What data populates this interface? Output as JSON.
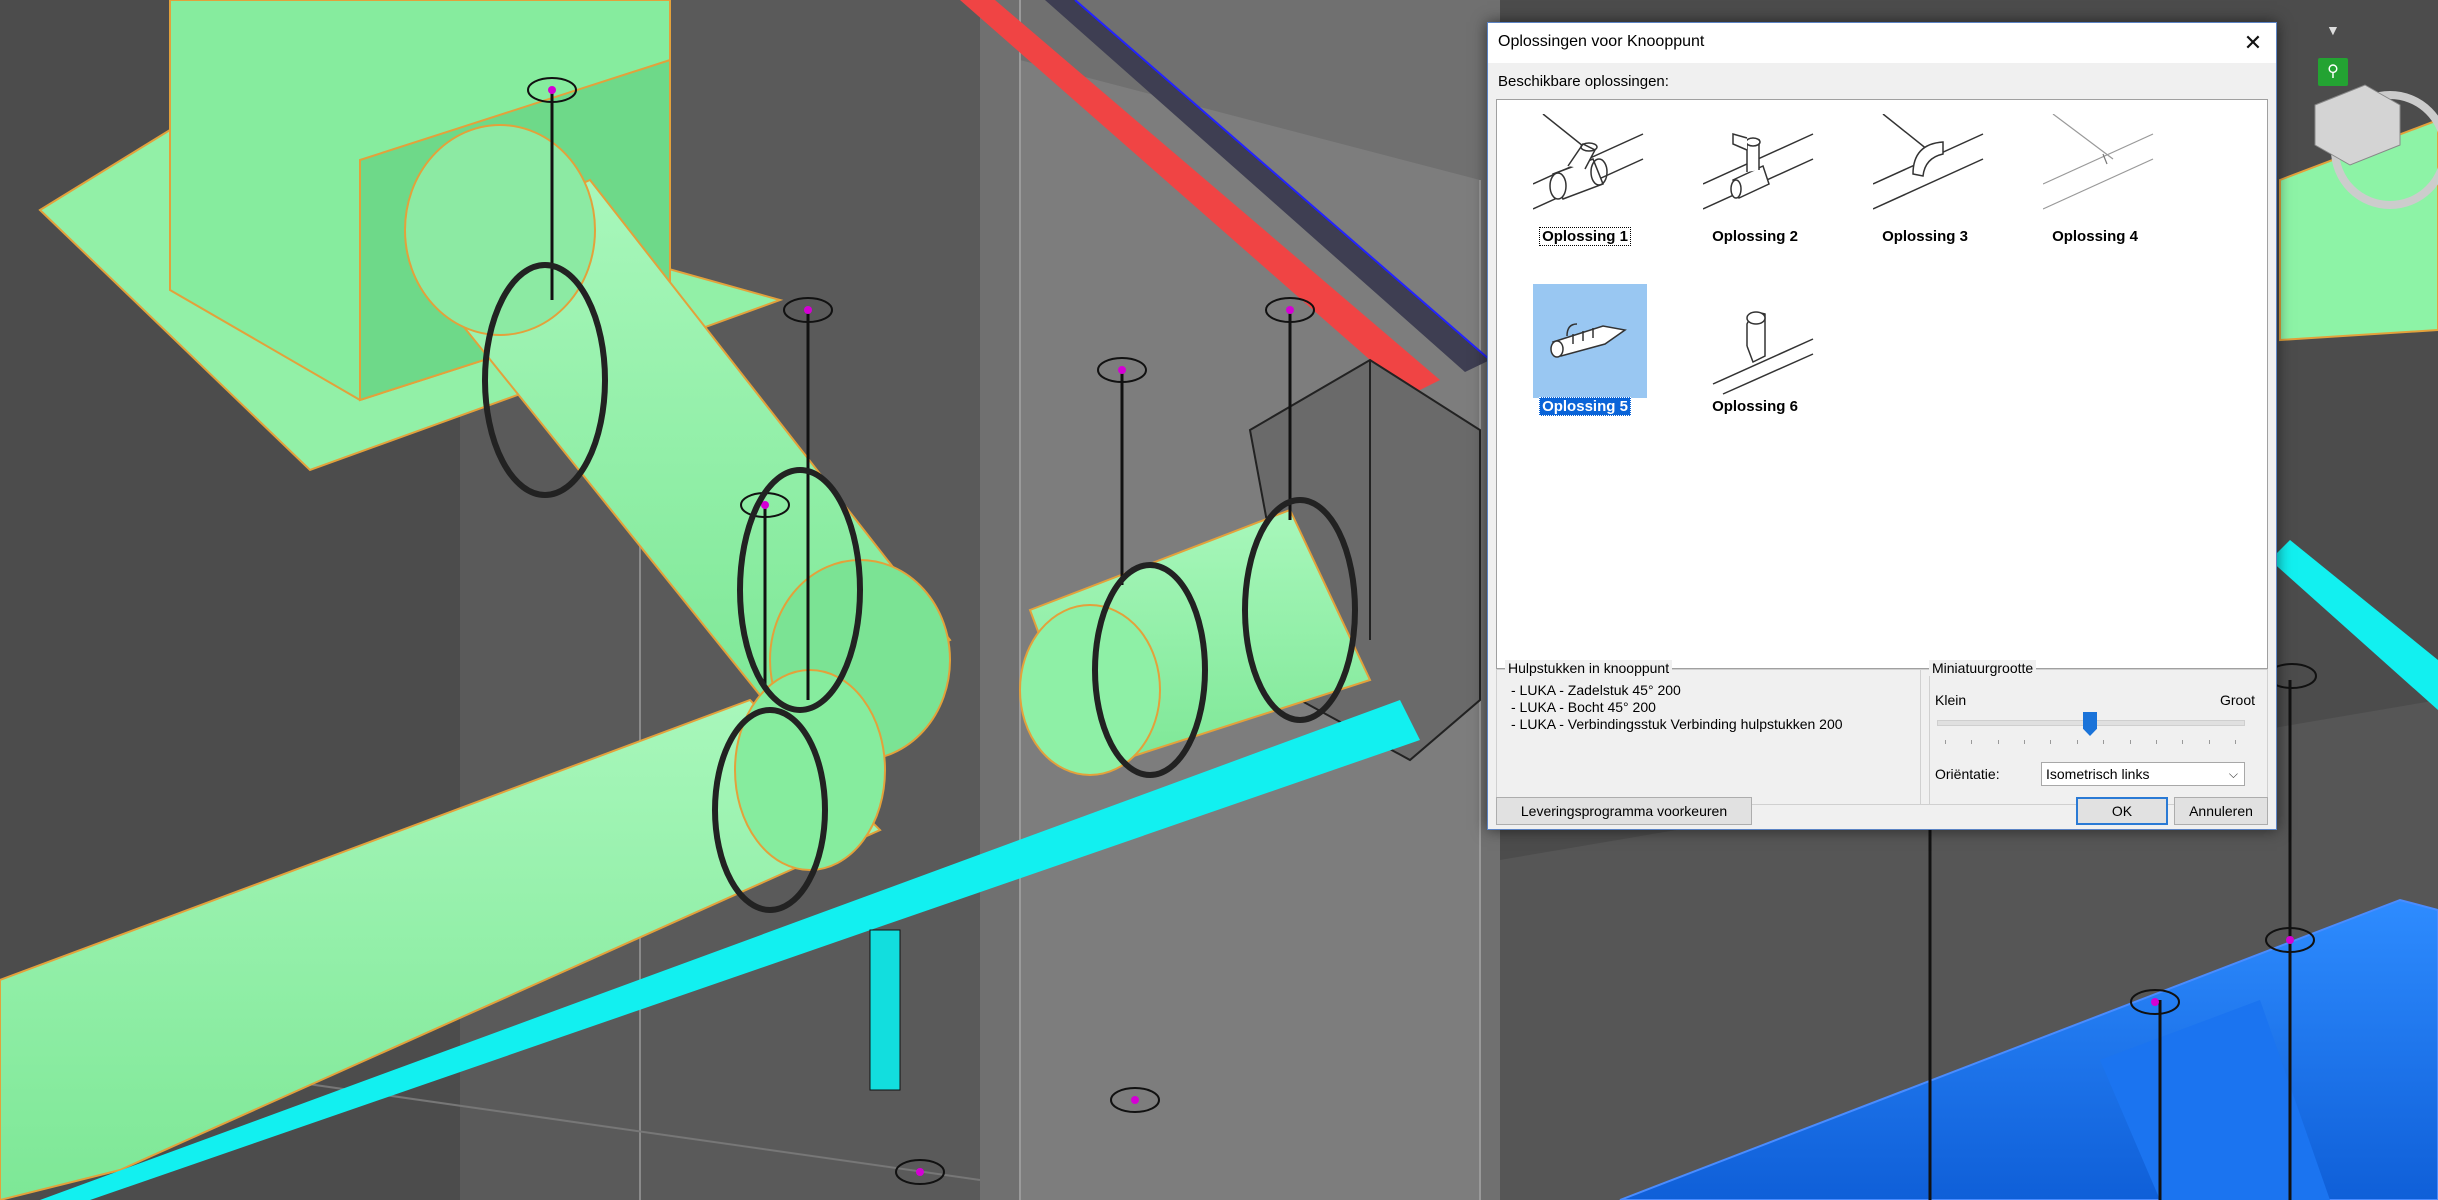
{
  "dialog": {
    "title": "Oplossingen voor Knooppunt",
    "close_glyph": "✕",
    "available_label": "Beschikbare oplossingen:",
    "solutions": [
      {
        "label": "Oplossing 1",
        "state": "focused"
      },
      {
        "label": "Oplossing 2",
        "state": "normal"
      },
      {
        "label": "Oplossing 3",
        "state": "normal"
      },
      {
        "label": "Oplossing 4",
        "state": "normal"
      },
      {
        "label": "Oplossing 5",
        "state": "selected"
      },
      {
        "label": "Oplossing 6",
        "state": "normal"
      }
    ],
    "fittings": {
      "title": "Hulpstukken in knooppunt",
      "items": [
        "- LUKA - Zadelstuk 45° 200",
        "- LUKA - Bocht 45° 200",
        "- LUKA - Verbindingsstuk Verbinding hulpstukken 200"
      ]
    },
    "thumbnail_size": {
      "title": "Miniatuurgrootte",
      "min_label": "Klein",
      "max_label": "Groot",
      "value_fraction": 0.5,
      "orientation_label": "Oriëntatie:",
      "orientation_value": "Isometrisch links"
    },
    "buttons": {
      "preferences": "Leveringsprogramma voorkeuren",
      "ok": "OK",
      "cancel": "Annuleren"
    }
  },
  "colors": {
    "duct_green": "#8df3a6",
    "pipe_cyan": "#12f0f0",
    "duct_blue": "#1b74f0",
    "selection_highlight": "#99c7f2",
    "selection_text_bg": "#0a64d8"
  },
  "icons": {
    "close": "close-icon",
    "search": "search-icon",
    "dropdown": "chevron-down-icon"
  }
}
